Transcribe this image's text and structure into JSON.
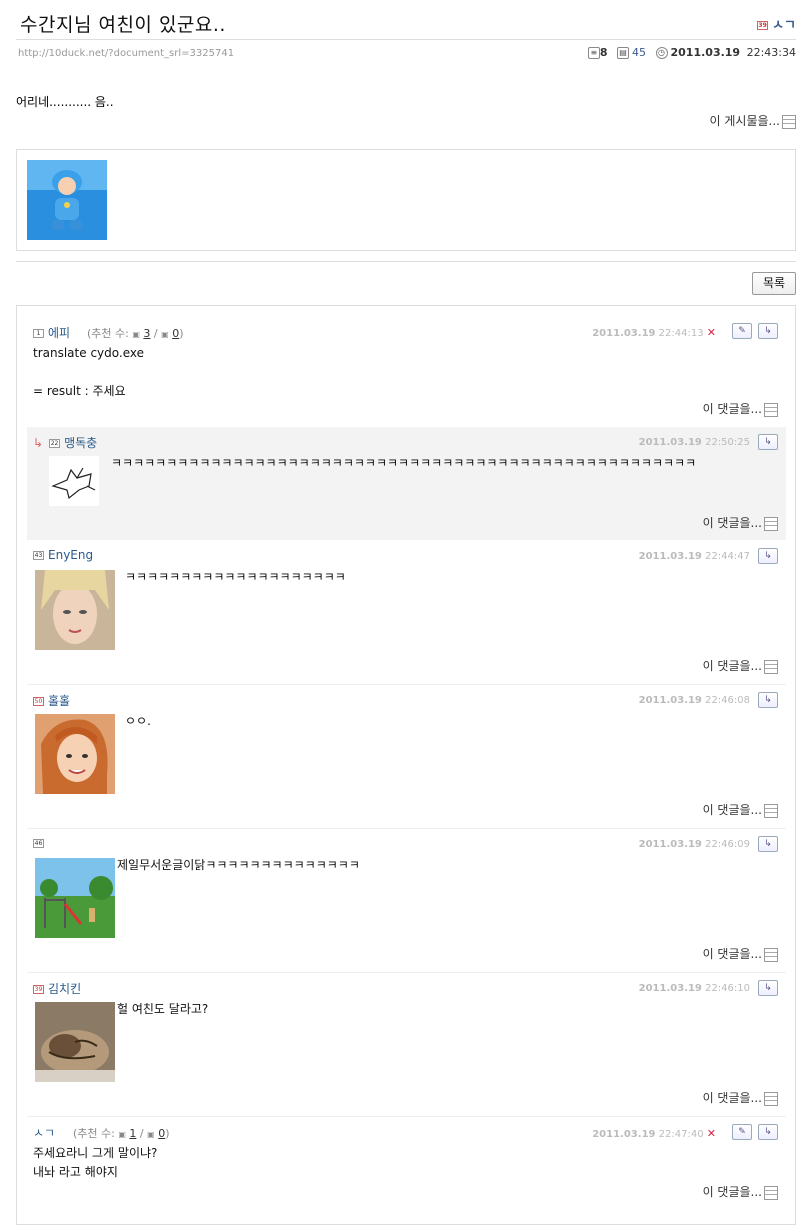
{
  "post": {
    "title": "수간지님 여친이 있군요..",
    "author_level": "39",
    "author": "ㅅㄱ",
    "url": "http://10duck.net/?document_srl=3325741",
    "comment_count": "8",
    "view_count": "45",
    "date": "2011.03.19",
    "time": "22:43:34",
    "content": "어리네........... 음..",
    "ref_label": "이 게시물을..."
  },
  "list_button": "목록",
  "comments": [
    {
      "level": "1",
      "name": "에피",
      "vote_label": "(추천 수:",
      "vote_up": "3",
      "vote_sep": "/",
      "vote_down": "0",
      "vote_end": ")",
      "date": "2011.03.19",
      "time": "22:44:13",
      "text": "translate cydo.exe\n\n= result : 주세요",
      "ref_label": "이 댓글을..."
    },
    {
      "level": "22",
      "name": "맹독충",
      "date": "2011.03.19",
      "time": "22:50:25",
      "text": "ㅋㅋㅋㅋㅋㅋㅋㅋㅋㅋㅋㅋㅋㅋㅋㅋㅋㅋㅋㅋㅋㅋㅋㅋㅋㅋㅋㅋㅋㅋㅋㅋㅋㅋㅋㅋㅋㅋㅋㅋㅋㅋㅋㅋㅋㅋㅋㅋㅋㅋㅋㅋㅋ",
      "ref_label": "이 댓글을..."
    },
    {
      "level": "43",
      "name": "EnyEng",
      "date": "2011.03.19",
      "time": "22:44:47",
      "text": "ㅋㅋㅋㅋㅋㅋㅋㅋㅋㅋㅋㅋㅋㅋㅋㅋㅋㅋㅋㅋ",
      "ref_label": "이 댓글을..."
    },
    {
      "level": "50",
      "name": "홀홀",
      "date": "2011.03.19",
      "time": "22:46:08",
      "text": "ㅇㅇ.",
      "ref_label": "이 댓글을..."
    },
    {
      "level": "46",
      "name": "",
      "date": "2011.03.19",
      "time": "22:46:09",
      "text": "제일무서운글이닭ㅋㅋㅋㅋㅋㅋㅋㅋㅋㅋㅋㅋㅋㅋ",
      "ref_label": "이 댓글을..."
    },
    {
      "level": "39",
      "name": "김치킨",
      "date": "2011.03.19",
      "time": "22:46:10",
      "text": "헐 여친도 달라고?",
      "ref_label": "이 댓글을..."
    },
    {
      "level": "",
      "name": "ㅅㄱ",
      "vote_label": "(추천 수:",
      "vote_up": "1",
      "vote_sep": "/",
      "vote_down": "0",
      "vote_end": ")",
      "date": "2011.03.19",
      "time": "22:47:40",
      "text": "주세요라니 그게 말이냐?\n내놔 라고 해야지",
      "ref_label": "이 댓글을..."
    }
  ]
}
